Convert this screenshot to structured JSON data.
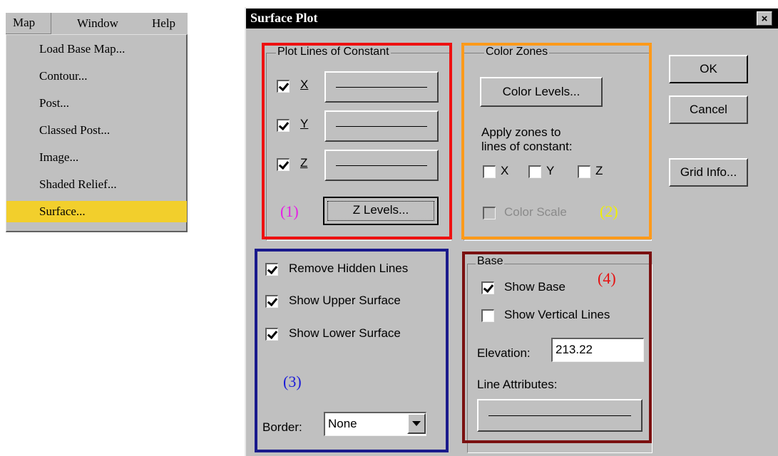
{
  "menubar": {
    "items": [
      "Map",
      "Window",
      "Help"
    ]
  },
  "map_menu": {
    "items": [
      "Load Base Map...",
      "Contour...",
      "Post...",
      "Classed Post...",
      "Image...",
      "Shaded Relief...",
      "Surface..."
    ],
    "selected": "Surface..."
  },
  "dialog": {
    "title": "Surface Plot",
    "close_glyph": "×",
    "plot_lines": {
      "title": "Plot Lines of Constant",
      "x_label": "X",
      "y_label": "Y",
      "z_label": "Z",
      "x_checked": true,
      "y_checked": true,
      "z_checked": true,
      "z_levels_label": "Z Levels..."
    },
    "color_zones": {
      "title": "Color Zones",
      "color_levels_label": "Color Levels...",
      "apply_text_1": "Apply zones to",
      "apply_text_2": "lines of constant:",
      "x_label": "X",
      "y_label": "Y",
      "z_label": "Z",
      "color_scale_label": "Color Scale"
    },
    "buttons": {
      "ok": "OK",
      "cancel": "Cancel",
      "grid_info": "Grid Info..."
    },
    "options": {
      "remove_hidden": "Remove Hidden Lines",
      "show_upper": "Show Upper Surface",
      "show_lower": "Show Lower Surface",
      "border_label": "Border:",
      "border_value": "None"
    },
    "base": {
      "title": "Base",
      "show_base": "Show Base",
      "show_vertical": "Show Vertical Lines",
      "elevation_label": "Elevation:",
      "elevation_value": "213.22",
      "line_attributes_label": "Line Attributes:"
    }
  },
  "annotations": {
    "a1": "(1)",
    "a2": "(2)",
    "a3": "(3)",
    "a4": "(4)"
  },
  "colors": {
    "highlight_1": "#ee1111",
    "highlight_2": "#ff9a1a",
    "highlight_3": "#1a1a8c",
    "highlight_4": "#7a1010",
    "label_1": "#e61ee6",
    "label_2": "#f0f000",
    "label_3": "#1a1ad8",
    "label_4": "#e61010",
    "menu_selected": "#f2cf2c"
  }
}
